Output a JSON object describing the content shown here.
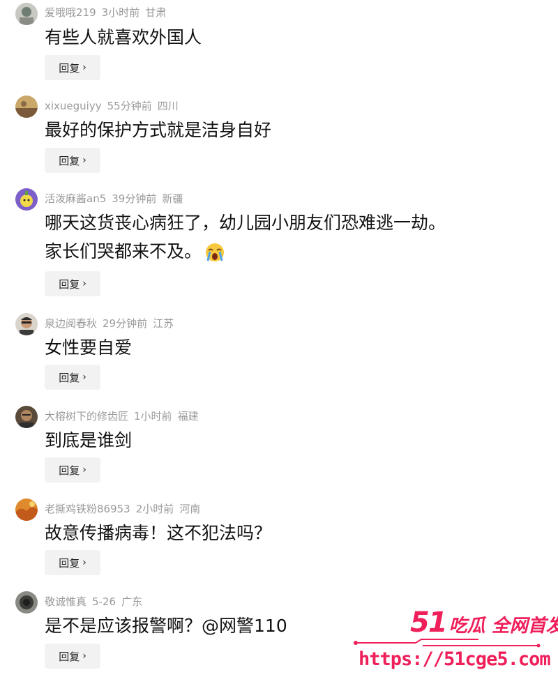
{
  "reply_label": "回复",
  "comments": [
    {
      "user": "爱哦哦219",
      "time": "3小时前",
      "location": "甘肃",
      "text": "有些人就喜欢外国人",
      "text2": ""
    },
    {
      "user": "xixueguiyy",
      "time": "55分钟前",
      "location": "四川",
      "text": "最好的保护方式就是洁身自好",
      "text2": ""
    },
    {
      "user": "活泼麻酱an5",
      "time": "39分钟前",
      "location": "新疆",
      "text": "哪天这货丧心病狂了，幼儿园小朋友们恐难逃一劫。",
      "text2": "家长们哭都来不及。"
    },
    {
      "user": "泉边阅春秋",
      "time": "29分钟前",
      "location": "江苏",
      "text": "女性要自爱",
      "text2": ""
    },
    {
      "user": "大榕树下的修齿匠",
      "time": "1小时前",
      "location": "福建",
      "text": "到底是谁剑",
      "text2": ""
    },
    {
      "user": "老撕鸡铁粉86953",
      "time": "2小时前",
      "location": "河南",
      "text": "故意传播病毒！这不犯法吗？",
      "text2": ""
    },
    {
      "user": "敬诚惟真",
      "time": "5-26",
      "location": "广东",
      "text": "是不是应该报警啊？@网警110",
      "text2": ""
    }
  ],
  "watermark": {
    "number": "51",
    "tagline": "吃瓜 全网首发",
    "url": "https://51cge5.com"
  },
  "colors": {
    "meta_gray": "#9a9a9a",
    "reply_bg": "#f2f2f2",
    "watermark_red": "#ef1f5a"
  }
}
